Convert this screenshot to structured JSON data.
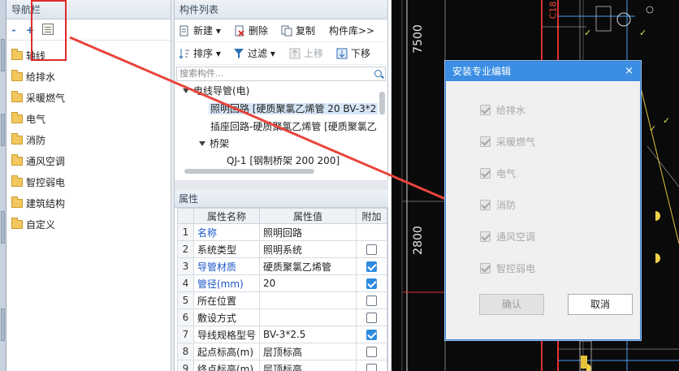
{
  "nav": {
    "title": "导航栏",
    "tools": [
      "-",
      "+"
    ],
    "items": [
      "轴线",
      "给排水",
      "采暖燃气",
      "电气",
      "消防",
      "通风空调",
      "智控弱电",
      "建筑结构",
      "自定义"
    ]
  },
  "component_list": {
    "title": "构件列表",
    "toolbar1": {
      "new": "新建",
      "delete": "删除",
      "copy": "复制",
      "library": "构件库>>"
    },
    "toolbar2": {
      "sort": "排序",
      "filter": "过滤",
      "up": "上移",
      "down": "下移"
    },
    "search_placeholder": "搜索构件...",
    "tree": {
      "group": "电线导管(电)",
      "item1": "照明回路 [硬质聚氯乙烯管 20 BV-3*2",
      "item2": "插座回路-硬质聚氯乙烯管 [硬质聚氯乙",
      "subgroup": "桥架",
      "item3": "QJ-1 [钢制桥架 200 200]"
    }
  },
  "properties": {
    "title": "属性",
    "headers": [
      "属性名称",
      "属性值",
      "附加"
    ],
    "rows": [
      {
        "n": "1",
        "name": "名称",
        "value": "照明回路",
        "extra": null,
        "blue": true
      },
      {
        "n": "2",
        "name": "系统类型",
        "value": "照明系统",
        "extra": false,
        "blue": false
      },
      {
        "n": "3",
        "name": "导管材质",
        "value": "硬质聚氯乙烯管",
        "extra": true,
        "blue": true
      },
      {
        "n": "4",
        "name": "管径(mm)",
        "value": "20",
        "extra": true,
        "blue": true
      },
      {
        "n": "5",
        "name": "所在位置",
        "value": "",
        "extra": false,
        "blue": false
      },
      {
        "n": "6",
        "name": "敷设方式",
        "value": "",
        "extra": false,
        "blue": false
      },
      {
        "n": "7",
        "name": "导线规格型号",
        "value": "BV-3*2.5",
        "extra": true,
        "blue": false
      },
      {
        "n": "8",
        "name": "起点标高(m)",
        "value": "层顶标高",
        "extra": false,
        "blue": false
      },
      {
        "n": "9",
        "name": "终点标高(m)",
        "value": "层顶标高",
        "extra": false,
        "blue": false
      }
    ]
  },
  "cad": {
    "dim1": "7500",
    "dim2": "2800",
    "label": "C18"
  },
  "dialog": {
    "title": "安装专业编辑",
    "close": "×",
    "options": [
      "给排水",
      "采暖燃气",
      "电气",
      "消防",
      "通风空调",
      "智控弱电"
    ],
    "ok": "确认",
    "cancel": "取消"
  }
}
